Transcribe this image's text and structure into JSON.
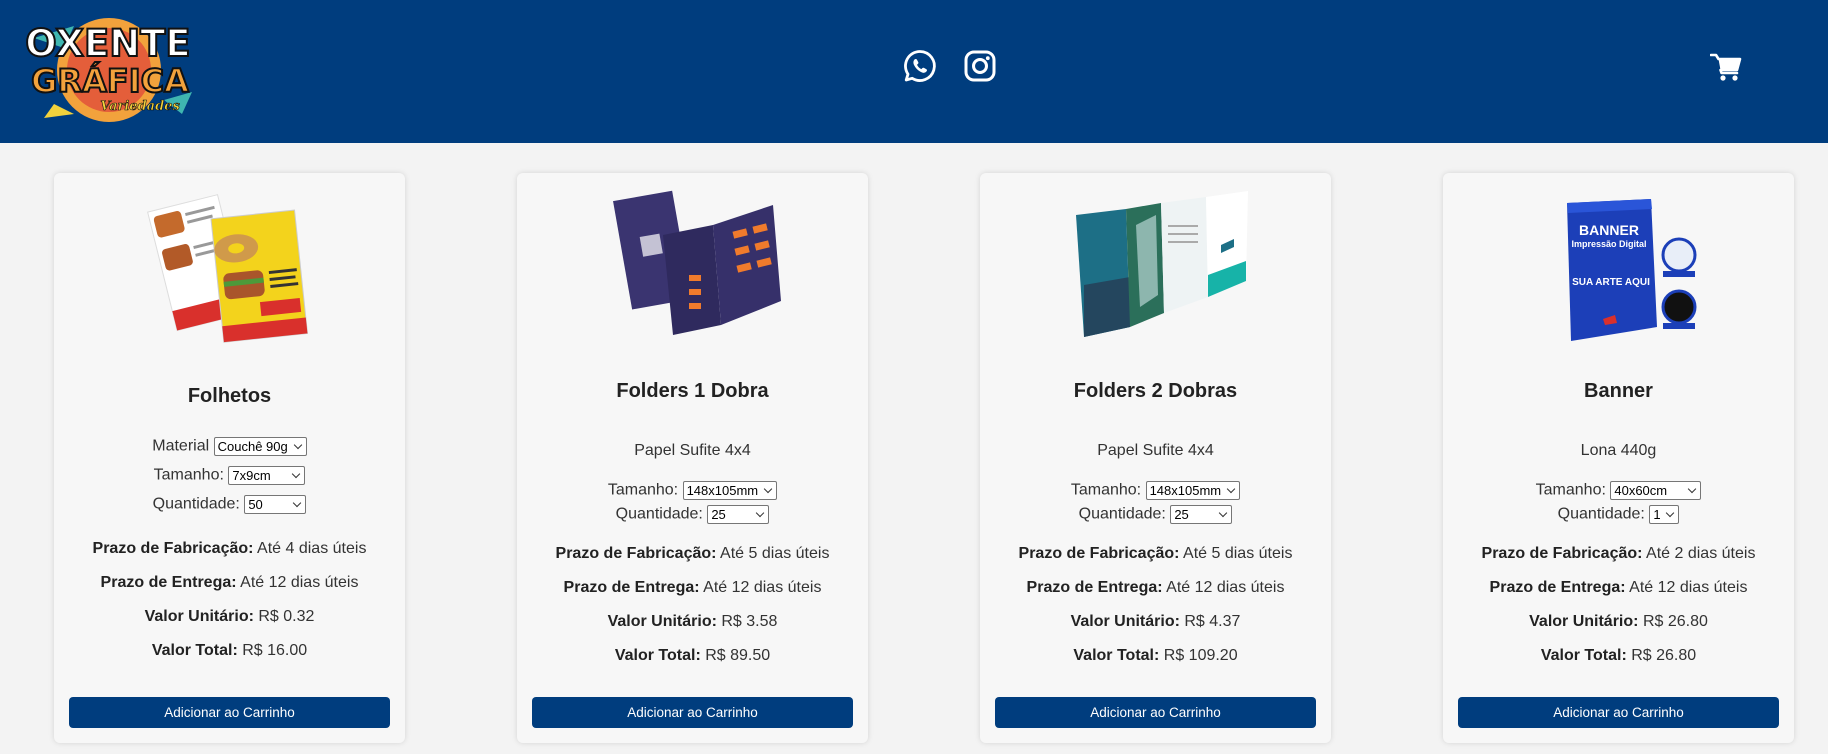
{
  "colors": {
    "header_bg": "#003d7e",
    "button_bg": "#003d7e",
    "page_bg": "#f3f3f3"
  },
  "header": {
    "logo": {
      "line1": "OXENTE",
      "line2": "GRÁFICA",
      "line3": "Variedades"
    },
    "icons": [
      "whatsapp-icon",
      "instagram-icon",
      "cart-icon"
    ]
  },
  "products": [
    {
      "title": "Folhetos",
      "paper": "",
      "material_label": "Material",
      "material_value": "Couchê 90g",
      "size_label": "Tamanho:",
      "size_value": "7x9cm",
      "qty_label": "Quantidade:",
      "qty_value": "50",
      "fab_label": "Prazo de Fabricação:",
      "fab_value": "Até 4 dias úteis",
      "delivery_label": "Prazo de Entrega:",
      "delivery_value": "Até 12 dias úteis",
      "unit_label": "Valor Unitário:",
      "unit_value": "R$ 0.32",
      "total_label": "Valor Total:",
      "total_value": "R$ 16.00",
      "button": "Adicionar ao Carrinho"
    },
    {
      "title": "Folders 1 Dobra",
      "paper": "Papel Sufite 4x4",
      "size_label": "Tamanho:",
      "size_value": "148x105mm",
      "qty_label": "Quantidade:",
      "qty_value": "25",
      "fab_label": "Prazo de Fabricação:",
      "fab_value": "Até 5 dias úteis",
      "delivery_label": "Prazo de Entrega:",
      "delivery_value": "Até 12 dias úteis",
      "unit_label": "Valor Unitário:",
      "unit_value": "R$ 3.58",
      "total_label": "Valor Total:",
      "total_value": "R$ 89.50",
      "button": "Adicionar ao Carrinho"
    },
    {
      "title": "Folders 2 Dobras",
      "paper": "Papel Sufite 4x4",
      "size_label": "Tamanho:",
      "size_value": "148x105mm",
      "qty_label": "Quantidade:",
      "qty_value": "25",
      "fab_label": "Prazo de Fabricação:",
      "fab_value": "Até 5 dias úteis",
      "delivery_label": "Prazo de Entrega:",
      "delivery_value": "Até 12 dias úteis",
      "unit_label": "Valor Unitário:",
      "unit_value": "R$ 4.37",
      "total_label": "Valor Total:",
      "total_value": "R$ 109.20",
      "button": "Adicionar ao Carrinho"
    },
    {
      "title": "Banner",
      "paper": "Lona 440g",
      "size_label": "Tamanho:",
      "size_value": "40x60cm",
      "qty_label": "Quantidade:",
      "qty_value": "1",
      "fab_label": "Prazo de Fabricação:",
      "fab_value": "Até 2 dias úteis",
      "delivery_label": "Prazo de Entrega:",
      "delivery_value": "Até 12 dias úteis",
      "unit_label": "Valor Unitário:",
      "unit_value": "R$ 26.80",
      "total_label": "Valor Total:",
      "total_value": "R$ 26.80",
      "button": "Adicionar ao Carrinho",
      "image_text": {
        "banner_title": "BANNER",
        "banner_sub": "Impressão Digital",
        "banner_body": "SUA ARTE AQUI"
      }
    }
  ]
}
